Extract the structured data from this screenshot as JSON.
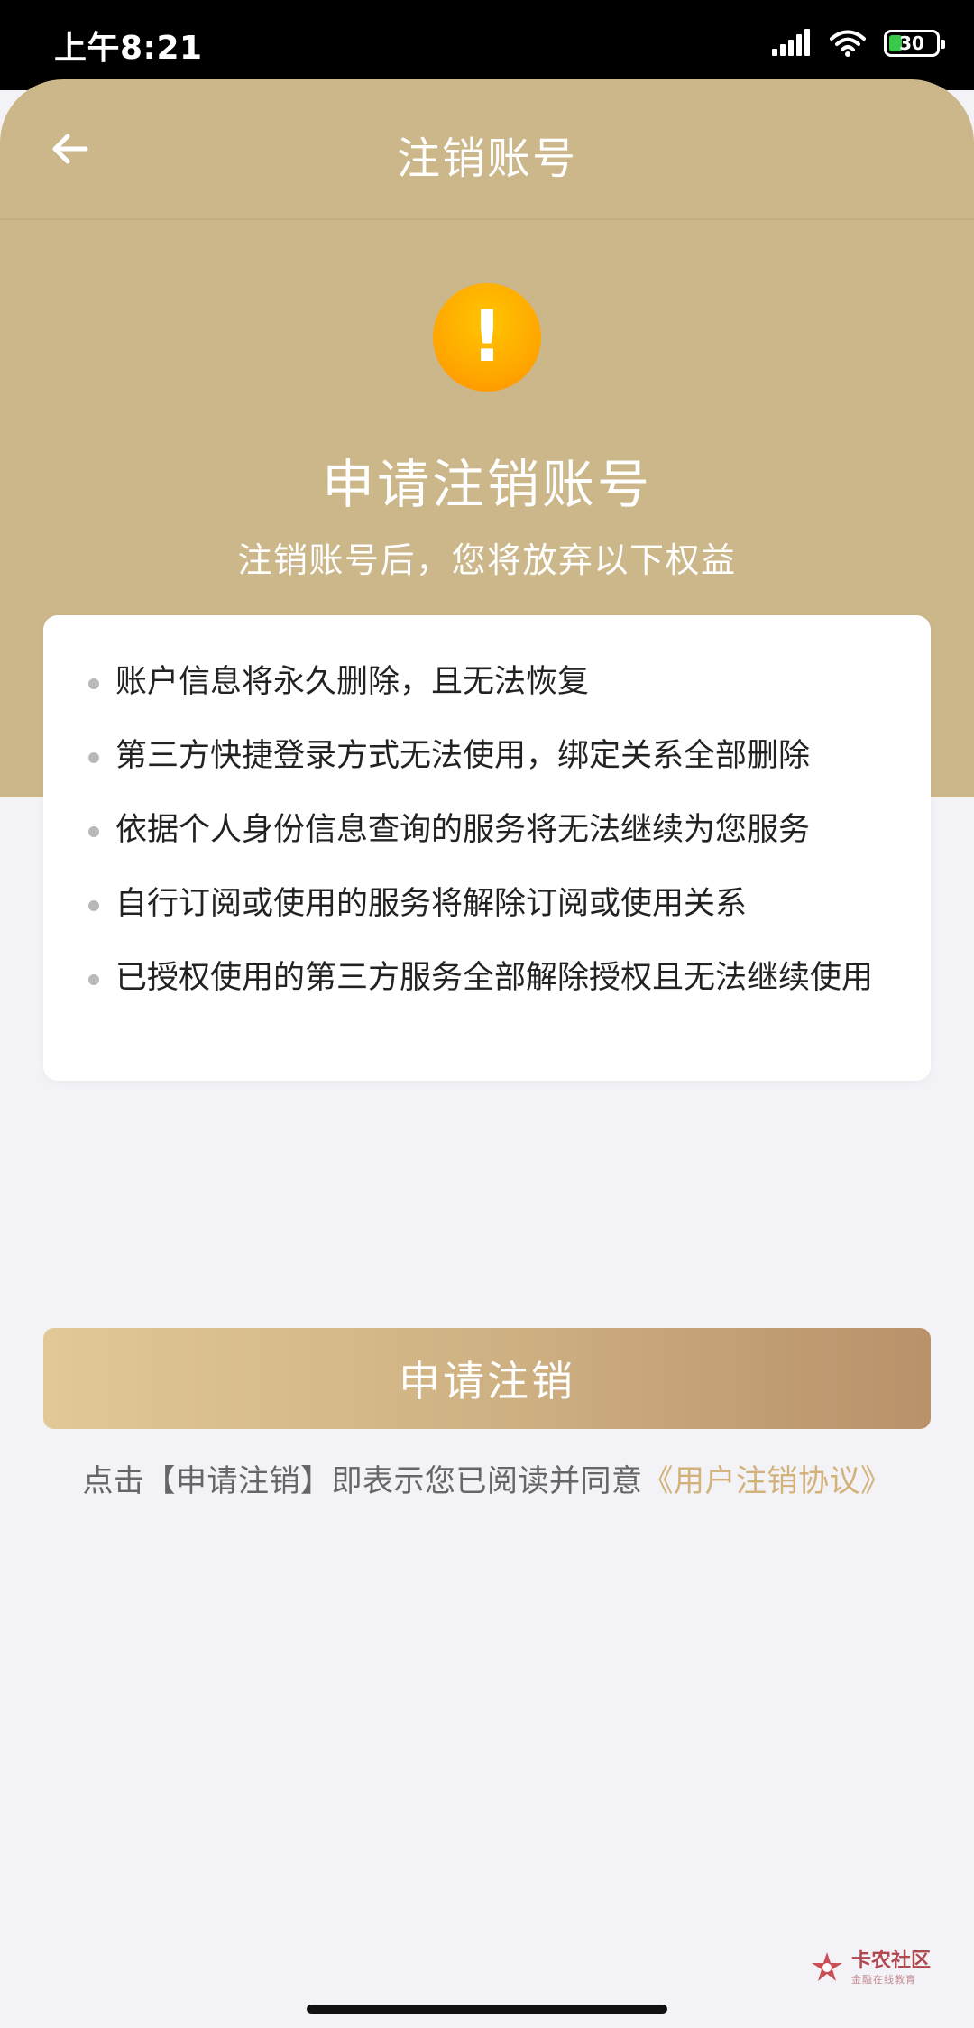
{
  "status_bar": {
    "time": "上午8:21",
    "battery": "30",
    "icons": [
      "signal-icon",
      "wifi-icon",
      "battery-icon"
    ]
  },
  "nav": {
    "back_icon": "back-arrow-icon",
    "title": "注销账号"
  },
  "hero": {
    "icon": "warning-icon",
    "icon_glyph": "!",
    "title": "申请注销账号",
    "subtitle": "注销账号后，您将放弃以下权益"
  },
  "benefits": [
    "账户信息将永久删除，且无法恢复",
    "第三方快捷登录方式无法使用，绑定关系全部删除",
    "依据个人身份信息查询的服务将无法继续为您服务",
    "自行订阅或使用的服务将解除订阅或使用关系",
    "已授权使用的第三方服务全部解除授权且无法继续使用"
  ],
  "actions": {
    "apply_label": "申请注销",
    "agreement_prefix": "点击【申请注销】即表示您已阅读并同意",
    "agreement_link": "《用户注销协议》"
  },
  "watermark": {
    "main": "卡农社区",
    "sub": "金融在线教育"
  },
  "colors": {
    "header_gold": "#cbb78a",
    "accent_link": "#d3b27a",
    "warning_orange": "#ffa800",
    "page_background": "#f2f2f7"
  }
}
